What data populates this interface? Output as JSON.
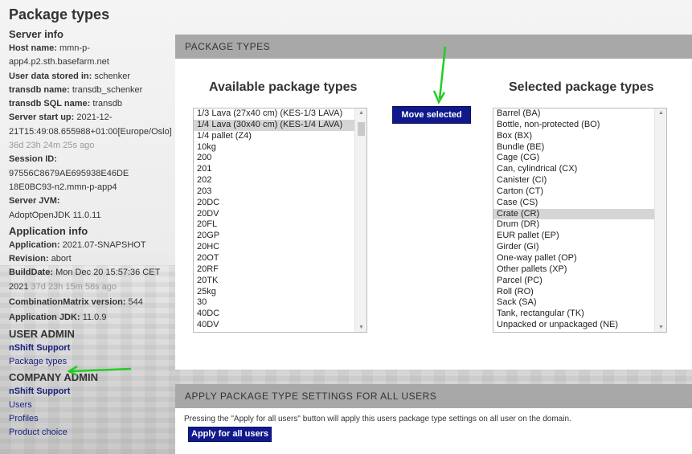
{
  "page_title": "Package types",
  "server_info": {
    "heading": "Server info",
    "host_label": "Host name:",
    "host_value_1": "mmn-p-",
    "host_value_2": "app4.p2.sth.basefarm.net",
    "user_data_label": "User data stored in:",
    "user_data_value": "schenker",
    "transdb_label": "transdb name:",
    "transdb_value": "transdb_schenker",
    "transdb_sql_label": "transdb SQL name:",
    "transdb_sql_value": "transdb",
    "start_label": "Server start up:",
    "start_value_1": "2021-12-",
    "start_value_2": "21T15:49:08.655988+01:00[Europe/Oslo]",
    "uptime": "36d 23h 24m 25s ago",
    "session_label": "Session ID:",
    "session_value_1": "97556C8679AE695938E46DE",
    "session_value_2": "18E0BC93-n2.mmn-p-app4",
    "jvm_label": "Server JVM:",
    "jvm_value": "AdoptOpenJDK 11.0.11"
  },
  "app_info": {
    "heading": "Application info",
    "app_label": "Application:",
    "app_value": "2021.07-SNAPSHOT",
    "rev_label": "Revision:",
    "rev_value": "abort",
    "build_label": "BuildDate:",
    "build_value_1": "Mon Dec 20 15:57:36 CET",
    "build_value_2": "2021",
    "build_ago": "37d 23h 15m 58s ago",
    "matrix_label": "CombinationMatrix version:",
    "matrix_value": "544",
    "jdk_label": "Application JDK:",
    "jdk_value": "11.0.9"
  },
  "user_admin": {
    "heading": "USER ADMIN",
    "links": [
      "nShift Support",
      "Package types"
    ]
  },
  "company_admin": {
    "heading": "COMPANY ADMIN",
    "links": [
      "nShift Support",
      "Users",
      "Profiles",
      "Product choice"
    ]
  },
  "package_panel": {
    "header": "PACKAGE TYPES",
    "available_title": "Available package types",
    "selected_title": "Selected package types",
    "move_button": "Move selected",
    "available": [
      "1/3 Lava (27x40 cm) (KES-1/3 LAVA)",
      "1/4 Lava (30x40 cm) (KES-1/4 LAVA)",
      "1/4 pallet (Z4)",
      "10kg",
      "200",
      "201",
      "202",
      "203",
      "20DC",
      "20DV",
      "20FL",
      "20GP",
      "20HC",
      "20OT",
      "20RF",
      "20TK",
      "25kg",
      "30",
      "40DC",
      "40DV"
    ],
    "available_selected": "1/4 Lava (30x40 cm) (KES-1/4 LAVA)",
    "selected": [
      "Barrel (BA)",
      "Bottle, non-protected (BO)",
      "Box (BX)",
      "Bundle (BE)",
      "Cage (CG)",
      "Can, cylindrical (CX)",
      "Canister (CI)",
      "Carton (CT)",
      "Case (CS)",
      "Crate (CR)",
      "Drum (DR)",
      "EUR pallet (EP)",
      "Girder (GI)",
      "One-way pallet (OP)",
      "Other pallets (XP)",
      "Parcel (PC)",
      "Roll (RO)",
      "Sack (SA)",
      "Tank, rectangular (TK)",
      "Unpacked or unpackaged (NE)"
    ],
    "selected_selected": "Crate (CR)"
  },
  "apply_panel": {
    "header": "APPLY PACKAGE TYPE SETTINGS FOR ALL USERS",
    "text": "Pressing the \"Apply for all users\" button will apply this users package type settings on all user on the domain.",
    "button": "Apply for all users"
  },
  "colors": {
    "button_bg": "#10198c",
    "link": "#1a237e",
    "header_bg": "#a8a8a8",
    "annotation_arrow": "#22cc22"
  }
}
